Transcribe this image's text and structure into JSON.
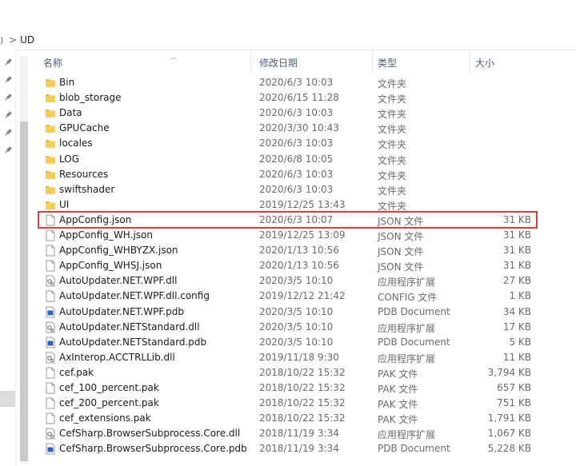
{
  "breadcrumb": {
    "prev": ")",
    "separator": ">",
    "current": "UD"
  },
  "columns": {
    "name": "名称",
    "date": "修改日期",
    "type": "类型",
    "size": "大小"
  },
  "colors": {
    "highlight": "#e03c3c",
    "folder": "#e8b93c",
    "header_text": "#4c607a"
  },
  "files": [
    {
      "name": "Bin",
      "date": "2020/6/3 10:03",
      "type": "文件夹",
      "size": "",
      "icon": "folder-icon"
    },
    {
      "name": "blob_storage",
      "date": "2020/6/15 11:28",
      "type": "文件夹",
      "size": "",
      "icon": "folder-icon"
    },
    {
      "name": "Data",
      "date": "2020/6/3 10:03",
      "type": "文件夹",
      "size": "",
      "icon": "folder-icon"
    },
    {
      "name": "GPUCache",
      "date": "2020/3/30 10:43",
      "type": "文件夹",
      "size": "",
      "icon": "folder-icon"
    },
    {
      "name": "locales",
      "date": "2020/6/3 10:03",
      "type": "文件夹",
      "size": "",
      "icon": "folder-icon"
    },
    {
      "name": "LOG",
      "date": "2020/6/8 10:05",
      "type": "文件夹",
      "size": "",
      "icon": "folder-icon"
    },
    {
      "name": "Resources",
      "date": "2020/6/3 10:03",
      "type": "文件夹",
      "size": "",
      "icon": "folder-icon"
    },
    {
      "name": "swiftshader",
      "date": "2020/6/3 10:03",
      "type": "文件夹",
      "size": "",
      "icon": "folder-icon"
    },
    {
      "name": "UI",
      "date": "2019/12/25 13:43",
      "type": "文件夹",
      "size": "",
      "icon": "folder-icon"
    },
    {
      "name": "AppConfig.json",
      "date": "2020/6/3 10:07",
      "type": "JSON 文件",
      "size": "31 KB",
      "icon": "file-icon",
      "highlighted": true
    },
    {
      "name": "AppConfig_WH.json",
      "date": "2019/12/25 13:09",
      "type": "JSON 文件",
      "size": "31 KB",
      "icon": "file-icon"
    },
    {
      "name": "AppConfig_WHBYZX.json",
      "date": "2020/1/13 10:56",
      "type": "JSON 文件",
      "size": "31 KB",
      "icon": "file-icon"
    },
    {
      "name": "AppConfig_WHSJ.json",
      "date": "2020/1/13 10:56",
      "type": "JSON 文件",
      "size": "31 KB",
      "icon": "file-icon"
    },
    {
      "name": "AutoUpdater.NET.WPF.dll",
      "date": "2020/3/5 10:10",
      "type": "应用程序扩展",
      "size": "27 KB",
      "icon": "dll-icon"
    },
    {
      "name": "AutoUpdater.NET.WPF.dll.config",
      "date": "2019/12/12 21:42",
      "type": "CONFIG 文件",
      "size": "1 KB",
      "icon": "file-icon"
    },
    {
      "name": "AutoUpdater.NET.WPF.pdb",
      "date": "2020/3/5 10:10",
      "type": "PDB Document",
      "size": "34 KB",
      "icon": "pdb-icon"
    },
    {
      "name": "AutoUpdater.NETStandard.dll",
      "date": "2020/3/5 10:10",
      "type": "应用程序扩展",
      "size": "17 KB",
      "icon": "dll-icon"
    },
    {
      "name": "AutoUpdater.NETStandard.pdb",
      "date": "2020/3/5 10:10",
      "type": "PDB Document",
      "size": "5 KB",
      "icon": "pdb-icon"
    },
    {
      "name": "AxInterop.ACCTRLLib.dll",
      "date": "2019/11/18 9:30",
      "type": "应用程序扩展",
      "size": "11 KB",
      "icon": "dll-icon"
    },
    {
      "name": "cef.pak",
      "date": "2018/10/22 15:32",
      "type": "PAK 文件",
      "size": "3,794 KB",
      "icon": "file-icon"
    },
    {
      "name": "cef_100_percent.pak",
      "date": "2018/10/22 15:32",
      "type": "PAK 文件",
      "size": "657 KB",
      "icon": "file-icon"
    },
    {
      "name": "cef_200_percent.pak",
      "date": "2018/10/22 15:32",
      "type": "PAK 文件",
      "size": "751 KB",
      "icon": "file-icon"
    },
    {
      "name": "cef_extensions.pak",
      "date": "2018/10/22 15:32",
      "type": "PAK 文件",
      "size": "1,791 KB",
      "icon": "file-icon"
    },
    {
      "name": "CefSharp.BrowserSubprocess.Core.dll",
      "date": "2018/11/19 3:34",
      "type": "应用程序扩展",
      "size": "1,067 KB",
      "icon": "dll-icon"
    },
    {
      "name": "CefSharp.BrowserSubprocess.Core.pdb",
      "date": "2018/11/19 3:34",
      "type": "PDB Document",
      "size": "5,228 KB",
      "icon": "pdb-icon"
    }
  ]
}
